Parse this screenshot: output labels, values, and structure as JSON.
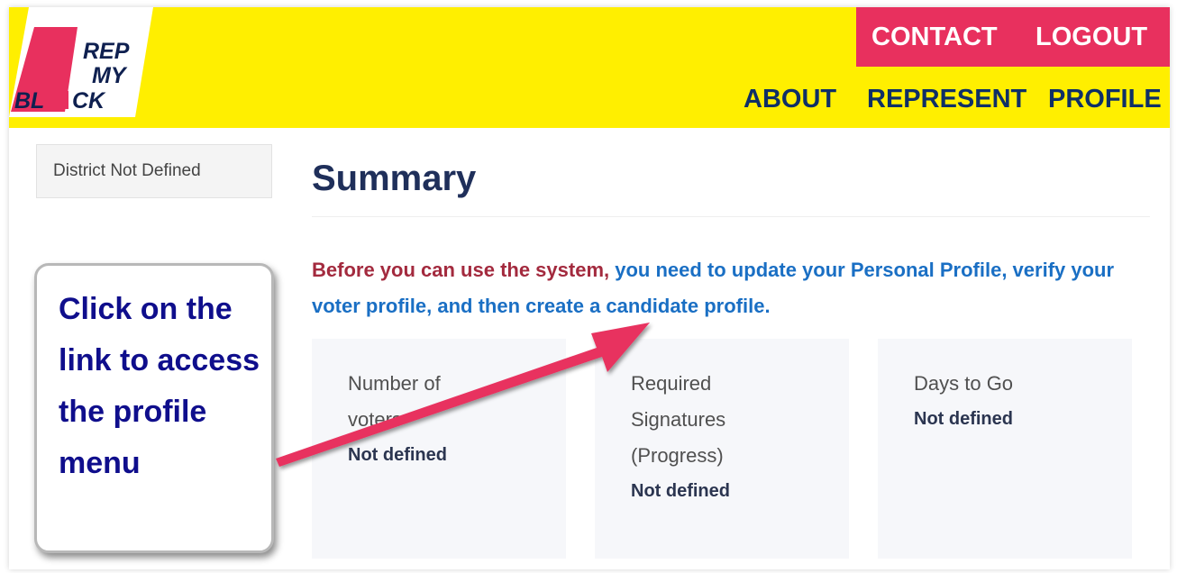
{
  "header": {
    "logo_text": [
      "REP",
      "MY",
      "BL",
      "CK"
    ],
    "nav_top": {
      "contact": "CONTACT",
      "logout": "LOGOUT"
    },
    "nav_bottom": {
      "about": "ABOUT",
      "represent": "REPRESENT",
      "profile": "PROFILE"
    }
  },
  "sidebar": {
    "district": "District Not Defined"
  },
  "main": {
    "title": "Summary",
    "notice": {
      "warning": "Before you can use the system,",
      "link": "you need to update your Personal Profile, verify your voter profile, and then create a candidate profile",
      "end": "."
    },
    "stats": [
      {
        "label": "Number of voters",
        "value": "Not defined"
      },
      {
        "label": "Required Signatures (Progress)",
        "value": "Not defined"
      },
      {
        "label": "Days to Go",
        "value": "Not defined"
      }
    ]
  },
  "callout": {
    "text": "Click on the link to access the profile menu"
  },
  "colors": {
    "header_bg": "#ffef00",
    "accent_pink": "#e8305e",
    "nav_dark": "#0f2f66",
    "warning_text": "#a32a3e",
    "link_text": "#1a6fc4",
    "callout_text": "#0f0e8c"
  },
  "icons": {
    "arrow": "annotation-arrow-icon"
  }
}
